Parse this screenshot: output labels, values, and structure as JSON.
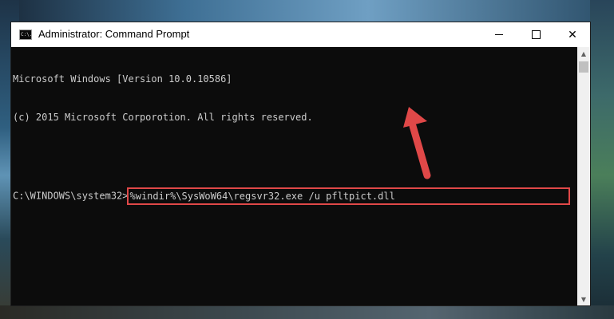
{
  "window": {
    "title": "Administrator: Command Prompt",
    "icon": "cmd-icon",
    "icon_text": "C:\\."
  },
  "controls": {
    "minimize_icon": "minimize-icon",
    "maximize_icon": "maximize-icon",
    "close_icon": "close-icon",
    "close_glyph": "✕"
  },
  "console": {
    "line1": "Microsoft Windows [Version 10.0.10586]",
    "line2": "(c) 2015 Microsoft Corporotion. All rights reserved.",
    "prompt": "C:\\WINDOWS\\system32>",
    "command": "%windir%\\SysWoW64\\regsvr32.exe /u pfltpict.dll"
  },
  "scrollbar": {
    "up_glyph": "▲",
    "down_glyph": "▼"
  },
  "colors": {
    "console_bg": "#0c0c0c",
    "console_text": "#cccccc",
    "highlight": "#e04848",
    "arrow": "#e04848"
  },
  "annotation": {
    "icon": "red-arrow-icon"
  }
}
